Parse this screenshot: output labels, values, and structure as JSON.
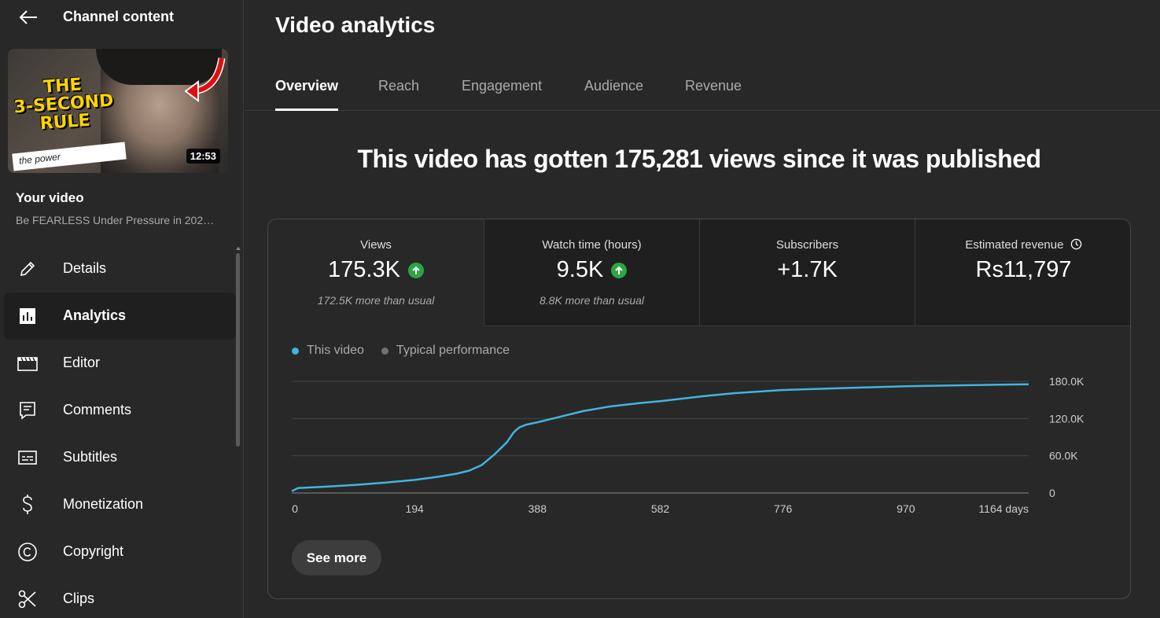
{
  "sidebar": {
    "header_title": "Channel content",
    "thumbnail": {
      "text_lines": [
        "THE",
        "3-SECOND",
        "RULE"
      ],
      "banner": "the power",
      "duration": "12:53"
    },
    "your_video_label": "Your video",
    "video_title": "Be FEARLESS Under Pressure in 202…",
    "items": [
      {
        "label": "Details",
        "icon": "pencil-icon"
      },
      {
        "label": "Analytics",
        "icon": "analytics-icon",
        "active": true
      },
      {
        "label": "Editor",
        "icon": "editor-icon"
      },
      {
        "label": "Comments",
        "icon": "comments-icon"
      },
      {
        "label": "Subtitles",
        "icon": "subtitles-icon"
      },
      {
        "label": "Monetization",
        "icon": "dollar-icon"
      },
      {
        "label": "Copyright",
        "icon": "copyright-icon"
      },
      {
        "label": "Clips",
        "icon": "scissors-icon"
      }
    ]
  },
  "main": {
    "title": "Video analytics",
    "tabs": [
      {
        "label": "Overview",
        "active": true
      },
      {
        "label": "Reach"
      },
      {
        "label": "Engagement"
      },
      {
        "label": "Audience"
      },
      {
        "label": "Revenue"
      }
    ],
    "headline": "This video has gotten 175,281 views since it was published",
    "metrics": [
      {
        "label": "Views",
        "value": "175.3K",
        "trend": "up",
        "sub": "172.5K more than usual"
      },
      {
        "label": "Watch time (hours)",
        "value": "9.5K",
        "trend": "up",
        "sub": "8.8K more than usual"
      },
      {
        "label": "Subscribers",
        "value": "+1.7K",
        "sub": ""
      },
      {
        "label": "Estimated revenue",
        "value": "Rs11,797",
        "sub": "",
        "icon": "clock-icon"
      }
    ],
    "see_more": "See more"
  },
  "colors": {
    "accent_line": "#41b4e0",
    "typical_dot": "#717171",
    "up_green": "#2ba640"
  },
  "chart_data": {
    "type": "line",
    "xlabel": "",
    "ylabel": "",
    "x_ticks": [
      "0",
      "194",
      "388",
      "582",
      "776",
      "970",
      "1164 days"
    ],
    "y_ticks": [
      "0",
      "60.0K",
      "120.0K",
      "180.0K"
    ],
    "xlim": [
      0,
      1164
    ],
    "ylim": [
      0,
      180000
    ],
    "legend": [
      "This video",
      "Typical performance"
    ],
    "legend_position": "top-left",
    "grid": true,
    "series": [
      {
        "name": "This video",
        "x": [
          0,
          10,
          50,
          100,
          150,
          194,
          230,
          260,
          280,
          300,
          320,
          330,
          340,
          350,
          355,
          360,
          370,
          388,
          420,
          460,
          500,
          550,
          582,
          650,
          700,
          776,
          850,
          900,
          970,
          1050,
          1100,
          1164
        ],
        "y": [
          3000,
          8000,
          10000,
          13000,
          17000,
          21000,
          26000,
          31000,
          36000,
          45000,
          62000,
          72000,
          82000,
          97000,
          102000,
          106000,
          110000,
          114000,
          122000,
          132000,
          139000,
          145000,
          148000,
          156000,
          161000,
          166000,
          168500,
          170000,
          172000,
          173500,
          174300,
          175300
        ]
      }
    ]
  }
}
